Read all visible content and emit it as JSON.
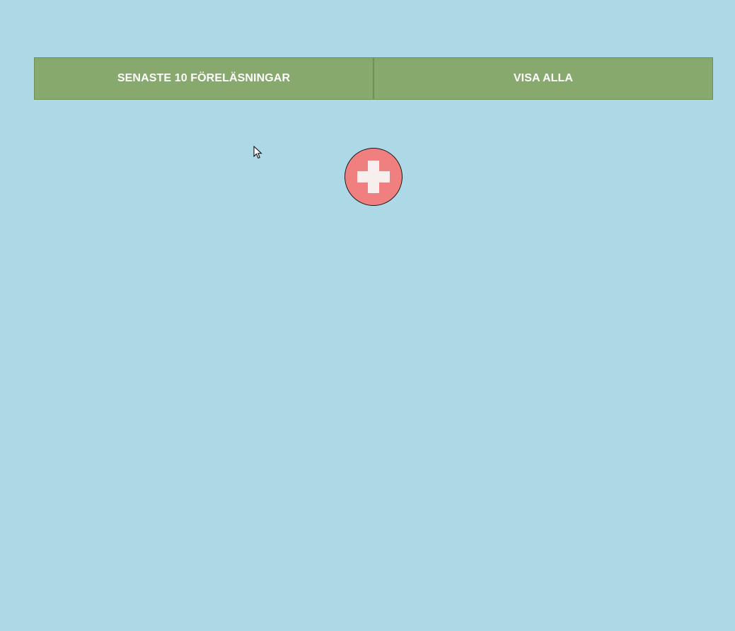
{
  "tabs": {
    "latest_label": "SENASTE 10 FÖRELÄSNINGAR",
    "all_label": "VISA ALLA"
  },
  "actions": {
    "add_icon": "plus-icon"
  },
  "colors": {
    "background": "#add8e6",
    "tab_background": "#88a96e",
    "tab_text": "#ffffff",
    "add_button": "#f08080",
    "plus_glyph": "#f7eeee"
  }
}
